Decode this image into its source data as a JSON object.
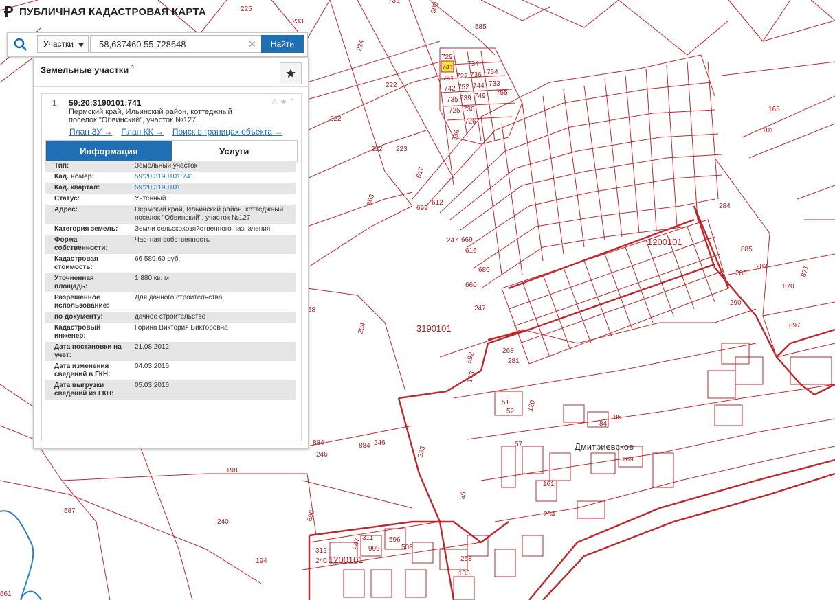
{
  "app": {
    "title": "ПУБЛИЧНАЯ КАДАСТРОВАЯ КАРТА"
  },
  "search": {
    "type_label": "Участки",
    "query": "58,637460 55,728648",
    "button_label": "Найти"
  },
  "panel": {
    "title": "Земельные участки",
    "count": "1"
  },
  "result": {
    "index": "1.",
    "cadastral_number": "59:20:3190101:741",
    "address": "Пермский край, Ильинский район, коттеджный поселок \"Обвинский\", участок №127",
    "links": [
      "План ЗУ →",
      "План КК →",
      "Поиск в границах объекта →"
    ]
  },
  "tabs": [
    {
      "label": "Информация",
      "active": true
    },
    {
      "label": "Услуги",
      "active": false
    }
  ],
  "info_rows": [
    {
      "key": "Тип:",
      "value": "Земельный участок"
    },
    {
      "key": "Кад. номер:",
      "value": "59:20:3190101:741",
      "link": true
    },
    {
      "key": "Кад. квартал:",
      "value": "59:20:3190101",
      "link": true
    },
    {
      "key": "Статус:",
      "value": "Учтенный"
    },
    {
      "key": "Адрес:",
      "value": "Пермский край, Ильинский район, коттеджный поселок \"Обвинский\", участок №127"
    },
    {
      "key": "Категория земель:",
      "value": "Земли сельскохозяйственного назначения"
    },
    {
      "key": "Форма собственности:",
      "value": "Частная собственность"
    },
    {
      "key": "Кадастровая стоимость:",
      "value": "66 589,60 руб."
    },
    {
      "key": "Уточненная площадь:",
      "value": "1 880 кв. м"
    },
    {
      "key": "Разрешенное использование:",
      "value": "Для дачного строительства"
    },
    {
      "key": "по документу:",
      "value": "дачное строительство"
    },
    {
      "key": "Кадастровый инженер:",
      "value": "Горина Виктория Викторовна"
    },
    {
      "key": "Дата постановки на учет:",
      "value": "21.08.2012"
    },
    {
      "key": "Дата изменения сведений в ГКН:",
      "value": "04.03.2016"
    },
    {
      "key": "Дата выгрузки сведений из ГКН:",
      "value": "05.03.2016"
    }
  ],
  "map": {
    "line_color": "#c0272d",
    "highlight_color": "#f5e642",
    "labels": [
      "225",
      "233",
      "739",
      "900",
      "585",
      "224",
      "222",
      "222",
      "232",
      "223",
      "729",
      "741",
      "734",
      "751",
      "727",
      "736",
      "754",
      "742",
      "752",
      "744",
      "733",
      "735",
      "739",
      "749",
      "725",
      "730",
      "726",
      "738",
      "755",
      "165",
      "284",
      "885",
      "282",
      "283",
      "870",
      "871",
      "897",
      "290",
      "1200101",
      "3190101",
      "247",
      "247",
      "204",
      "58",
      "884",
      "246",
      "884",
      "246",
      "233",
      "198",
      "587",
      "240",
      "194",
      "886",
      "1200101",
      "Дмитриевское",
      "592",
      "173",
      "268",
      "281",
      "51",
      "52",
      "120",
      "84",
      "85",
      "57",
      "169",
      "161",
      "35",
      "234",
      "247",
      "311",
      "999",
      "596",
      "508",
      "312",
      "240",
      "253",
      "133",
      "101",
      "863",
      "699",
      "612",
      "617",
      "616",
      "669",
      "660",
      "680",
      "661",
      "679",
      "1200101"
    ]
  }
}
